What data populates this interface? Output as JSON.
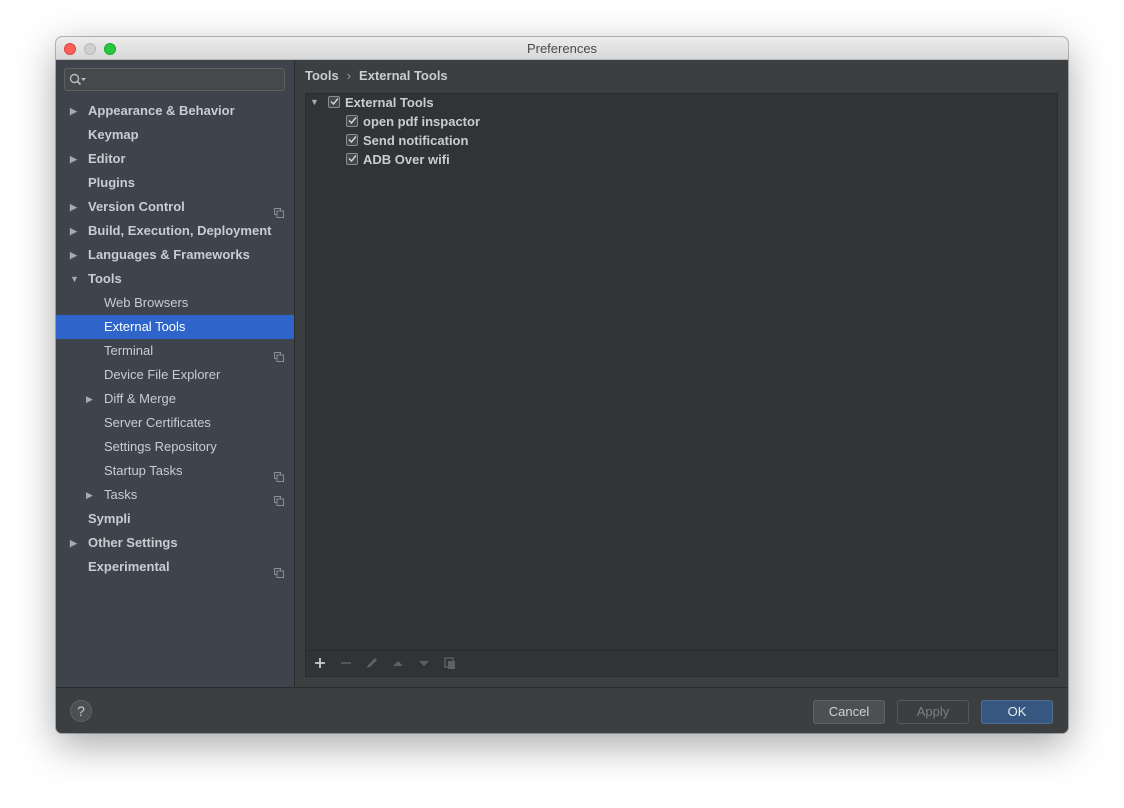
{
  "window": {
    "title": "Preferences"
  },
  "search": {
    "placeholder": ""
  },
  "sidebar": {
    "items": [
      {
        "label": "Appearance & Behavior",
        "expandable": true,
        "expanded": false,
        "level": 0,
        "project_icon": false
      },
      {
        "label": "Keymap",
        "expandable": false,
        "level": 0,
        "project_icon": false
      },
      {
        "label": "Editor",
        "expandable": true,
        "expanded": false,
        "level": 0,
        "project_icon": false
      },
      {
        "label": "Plugins",
        "expandable": false,
        "level": 0,
        "project_icon": false
      },
      {
        "label": "Version Control",
        "expandable": true,
        "expanded": false,
        "level": 0,
        "project_icon": true
      },
      {
        "label": "Build, Execution, Deployment",
        "expandable": true,
        "expanded": false,
        "level": 0,
        "project_icon": false
      },
      {
        "label": "Languages & Frameworks",
        "expandable": true,
        "expanded": false,
        "level": 0,
        "project_icon": false
      },
      {
        "label": "Tools",
        "expandable": true,
        "expanded": true,
        "level": 0,
        "project_icon": false
      },
      {
        "label": "Web Browsers",
        "expandable": false,
        "level": 1,
        "project_icon": false
      },
      {
        "label": "External Tools",
        "expandable": false,
        "level": 1,
        "project_icon": false,
        "selected": true
      },
      {
        "label": "Terminal",
        "expandable": false,
        "level": 1,
        "project_icon": true
      },
      {
        "label": "Device File Explorer",
        "expandable": false,
        "level": 1,
        "project_icon": false
      },
      {
        "label": "Diff & Merge",
        "expandable": true,
        "expanded": false,
        "level": 1,
        "project_icon": false
      },
      {
        "label": "Server Certificates",
        "expandable": false,
        "level": 1,
        "project_icon": false
      },
      {
        "label": "Settings Repository",
        "expandable": false,
        "level": 1,
        "project_icon": false
      },
      {
        "label": "Startup Tasks",
        "expandable": false,
        "level": 1,
        "project_icon": true
      },
      {
        "label": "Tasks",
        "expandable": true,
        "expanded": false,
        "level": 1,
        "project_icon": true
      },
      {
        "label": "Sympli",
        "expandable": false,
        "level": 0,
        "project_icon": false
      },
      {
        "label": "Other Settings",
        "expandable": true,
        "expanded": false,
        "level": 0,
        "project_icon": false
      },
      {
        "label": "Experimental",
        "expandable": false,
        "level": 0,
        "project_icon": true
      }
    ]
  },
  "breadcrumb": {
    "parent": "Tools",
    "separator": "›",
    "current": "External Tools"
  },
  "tree": {
    "group": {
      "label": "External Tools",
      "checked": true,
      "expanded": true
    },
    "children": [
      {
        "label": "open pdf inspactor",
        "checked": true
      },
      {
        "label": "Send notification",
        "checked": true
      },
      {
        "label": "ADB Over wifi",
        "checked": true
      }
    ]
  },
  "toolbar": {
    "buttons": [
      "add-icon",
      "remove-icon",
      "edit-icon",
      "move-up-icon",
      "move-down-icon",
      "copy-icon"
    ]
  },
  "footer": {
    "help_label": "?",
    "cancel_label": "Cancel",
    "apply_label": "Apply",
    "ok_label": "OK"
  },
  "colors": {
    "selection": "#2f65ca",
    "sidebar_bg": "#3e434c",
    "content_bg": "#3c3f41",
    "ok_button": "#365880"
  }
}
